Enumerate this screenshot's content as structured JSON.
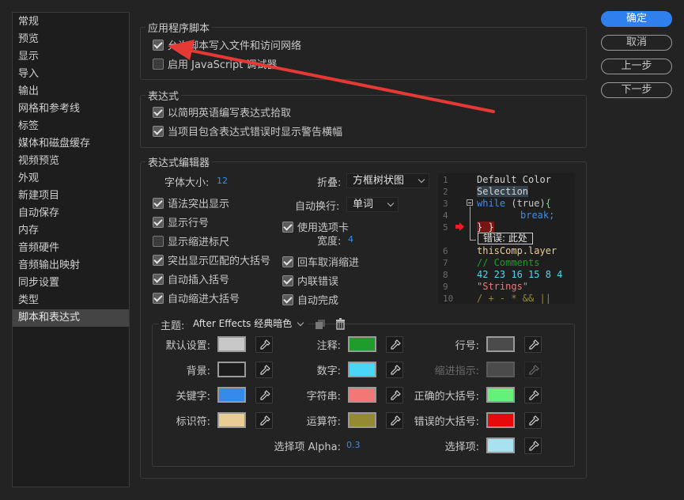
{
  "sidebar": {
    "items": [
      "常规",
      "预览",
      "显示",
      "导入",
      "输出",
      "网格和参考线",
      "标签",
      "媒体和磁盘缓存",
      "视频预览",
      "外观",
      "新建项目",
      "自动保存",
      "内存",
      "音频硬件",
      "音频输出映射",
      "同步设置",
      "类型",
      "脚本和表达式"
    ],
    "active_index": 17
  },
  "buttons": {
    "ok": "确定",
    "cancel": "取消",
    "prev": "上一步",
    "next": "下一步"
  },
  "app_scripts": {
    "title": "应用程序脚本",
    "allow_write": {
      "label": "允许脚本写入文件和访问网络",
      "checked": true
    },
    "enable_debugger": {
      "label": "启用 JavaScript 调试器",
      "checked": false
    }
  },
  "expressions": {
    "title": "表达式",
    "english_pickwhip": {
      "label": "以简明英语编写表达式拾取",
      "checked": true
    },
    "error_banner": {
      "label": "当项目包含表达式错误时显示警告横幅",
      "checked": true
    }
  },
  "editor": {
    "title": "表达式编辑器",
    "font_size_label": "字体大小:",
    "font_size_value": "12",
    "fold_label": "折叠:",
    "fold_value": "方框树状图",
    "wrap_label": "自动换行:",
    "wrap_value": "单词",
    "syntax_highlight": {
      "label": "语法突出显示",
      "checked": true
    },
    "line_numbers": {
      "label": "显示行号",
      "checked": true
    },
    "indent_guides": {
      "label": "显示缩进标尺",
      "checked": false
    },
    "match_brackets": {
      "label": "突出显示匹配的大括号",
      "checked": true
    },
    "auto_insert_brackets": {
      "label": "自动插入括号",
      "checked": true
    },
    "auto_indent_brackets": {
      "label": "自动缩进大括号",
      "checked": true
    },
    "use_tabs": {
      "label": "使用选项卡",
      "checked": true
    },
    "tab_width_label": "宽度:",
    "tab_width_value": "4",
    "return_unindent": {
      "label": "回车取消缩进",
      "checked": true
    },
    "inline_errors": {
      "label": "内联错误",
      "checked": true
    },
    "auto_complete": {
      "label": "自动完成",
      "checked": true
    }
  },
  "code_preview": {
    "line_numbers": [
      "1",
      "2",
      "3",
      "4",
      "5",
      "",
      "6",
      "7",
      "8",
      "9",
      "10"
    ],
    "lines": {
      "l1": "Default Color",
      "l2": "Selection",
      "l3a": "while ",
      "l3b": "(true)",
      "l3c": "{",
      "l4": "break;",
      "l5": "} }",
      "err": "错误: 此处",
      "l6": "thisComp.layer",
      "l7": "// Comments",
      "l8": "42 23 16 15 8 4",
      "l9": "\"Strings\"",
      "l10": "/ + - * && ||"
    }
  },
  "theme": {
    "label": "主题:",
    "value": "After Effects 经典暗色",
    "icons": [
      "copy-icon",
      "trash-icon"
    ],
    "colors": {
      "default": {
        "label": "默认设置:",
        "hex": "#c8c8c8"
      },
      "background": {
        "label": "背景:",
        "hex": "#1c1c1c"
      },
      "keyword": {
        "label": "关键字:",
        "hex": "#3589e8"
      },
      "identifier": {
        "label": "标识符:",
        "hex": "#e8cd94"
      },
      "comment": {
        "label": "注释:",
        "hex": "#1f9c2c"
      },
      "number": {
        "label": "数字:",
        "hex": "#4ad7f7"
      },
      "string": {
        "label": "字符串:",
        "hex": "#f27878"
      },
      "operator": {
        "label": "运算符:",
        "hex": "#948a33"
      },
      "line_number": {
        "label": "行号:",
        "hex": "#4b4b4b"
      },
      "indent_guide": {
        "label": "缩进指示:",
        "hex": "#4b4b4b"
      },
      "correct_bracket": {
        "label": "正确的大括号:",
        "hex": "#65f07a"
      },
      "wrong_bracket": {
        "label": "错误的大括号:",
        "hex": "#e60a0a"
      },
      "selection": {
        "label": "选择项:",
        "hex": "#a8e2f0"
      }
    },
    "alpha_label": "选择项 Alpha:",
    "alpha_value": "0.3"
  },
  "annotation_color": "#e53935"
}
